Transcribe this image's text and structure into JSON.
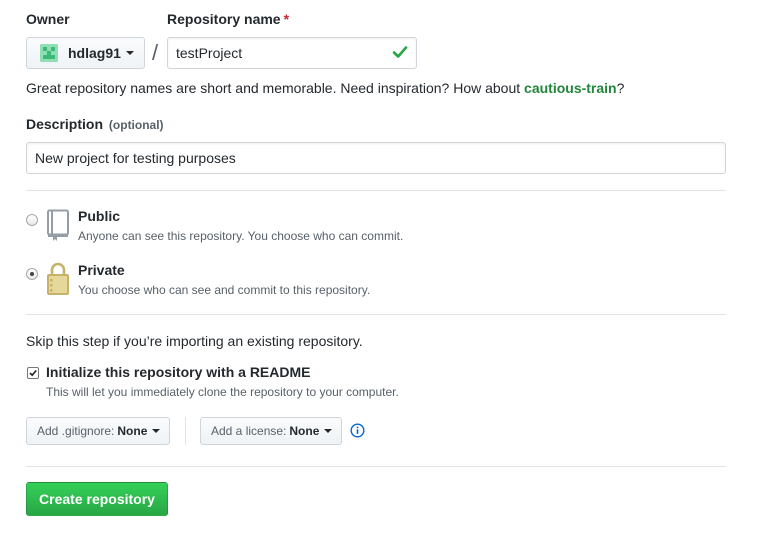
{
  "owner": {
    "label": "Owner",
    "value": "hdlag91"
  },
  "separator": "/",
  "repo_name": {
    "label": "Repository name",
    "required_mark": "*",
    "value": "testProject"
  },
  "hint": {
    "prefix": "Great repository names are short and memorable. Need inspiration? How about ",
    "suggestion": "cautious-train",
    "suffix": "?"
  },
  "description": {
    "label": "Description",
    "optional": "(optional)",
    "value": "New project for testing purposes"
  },
  "visibility": {
    "public": {
      "title": "Public",
      "note": "Anyone can see this repository. You choose who can commit.",
      "selected": false
    },
    "private": {
      "title": "Private",
      "note": "You choose who can see and commit to this repository.",
      "selected": true
    }
  },
  "init": {
    "skip_text": "Skip this step if you’re importing an existing repository.",
    "readme_title": "Initialize this repository with a README",
    "readme_note": "This will let you immediately clone the repository to your computer.",
    "readme_checked": true
  },
  "gitignore": {
    "label": "Add .gitignore:",
    "value": "None"
  },
  "license": {
    "label": "Add a license:",
    "value": "None"
  },
  "create_button": "Create repository",
  "colors": {
    "accent_green": "#28a745",
    "suggestion_green": "#22863a",
    "required_red": "#cb2431",
    "info_blue": "#0366d6"
  }
}
